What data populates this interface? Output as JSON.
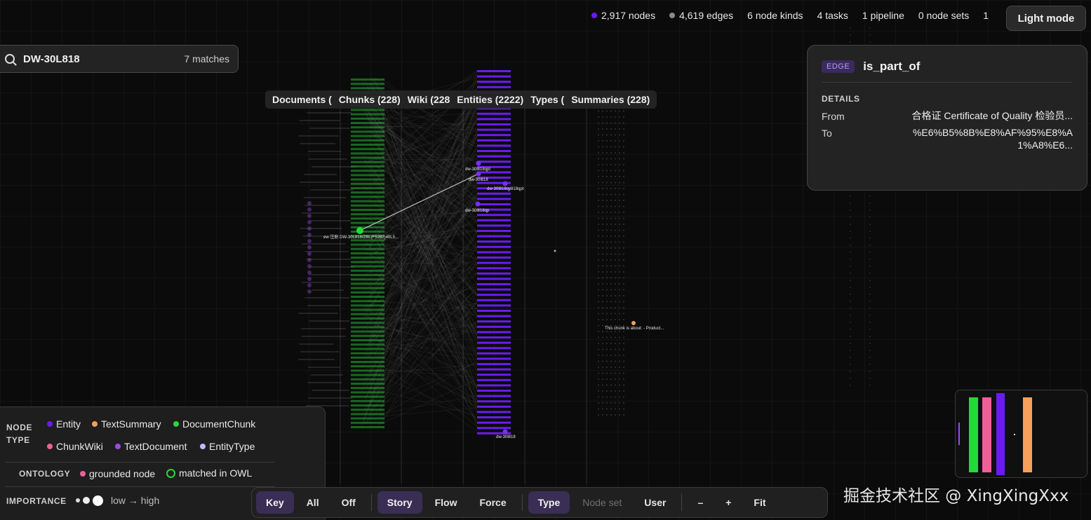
{
  "stats": [
    {
      "label": "2,917 nodes",
      "color": "#6a1bf0",
      "dot": true
    },
    {
      "label": "4,619 edges",
      "color": "#8a8a8a",
      "dot": true
    },
    {
      "label": "6 node kinds",
      "dot": false
    },
    {
      "label": "4 tasks",
      "dot": false
    },
    {
      "label": "1 pipeline",
      "dot": false
    },
    {
      "label": "0 node sets",
      "dot": false
    },
    {
      "label": "1",
      "dot": false
    }
  ],
  "theme_toggle": "Light mode",
  "search": {
    "value": "DW-30L818",
    "matches": "7 matches"
  },
  "columns": [
    "Documents (",
    "Chunks (228)",
    "Wiki (228",
    "Entities (2222)",
    "Types (",
    "Summaries (228)"
  ],
  "edge_panel": {
    "badge": "EDGE",
    "title": "is_part_of",
    "details_label": "DETAILS",
    "from_label": "From",
    "from_value": "合格证 Certificate of Quality 检验员...",
    "to_label": "To",
    "to_value": "%E6%B5%8B%E8%AF%95%E8%A1%A8%E6..."
  },
  "graph_labels": {
    "chunk_label": "ew 注册 DW-30L818/ZBL(F5282)40L5...",
    "summary_label": "This chunk is about: - Product...",
    "entity_labels": [
      "dw-30l818qpt",
      "dw-30l818",
      "dw-30l818qy818qpt",
      "dw-30l818qp",
      "dw-30l818"
    ]
  },
  "legend": {
    "node_type_label_1": "NODE",
    "node_type_label_2": "TYPE",
    "node_types": [
      {
        "name": "Entity",
        "color": "#6a1bf0"
      },
      {
        "name": "TextSummary",
        "color": "#f5a05a"
      },
      {
        "name": "DocumentChunk",
        "color": "#26d93a"
      },
      {
        "name": "ChunkWiki",
        "color": "#ee5f97"
      },
      {
        "name": "TextDocument",
        "color": "#9a4ae8"
      },
      {
        "name": "EntityType",
        "color": "#c7b7f4"
      }
    ],
    "ontology_label": "ONTOLOGY",
    "grounded": "grounded node",
    "grounded_color": "#ee5f97",
    "matched": "matched in OWL",
    "importance_label": "IMPORTANCE",
    "importance_text": "low → high"
  },
  "toolbar": {
    "group1": [
      {
        "label": "Key",
        "active": true
      },
      {
        "label": "All"
      },
      {
        "label": "Off"
      }
    ],
    "group2": [
      {
        "label": "Story",
        "active": true
      },
      {
        "label": "Flow"
      },
      {
        "label": "Force"
      }
    ],
    "group3": [
      {
        "label": "Type",
        "active": true
      },
      {
        "label": "Node set",
        "disabled": true
      },
      {
        "label": "User"
      }
    ],
    "group4": [
      {
        "label": "–"
      },
      {
        "label": "+"
      },
      {
        "label": "Fit"
      }
    ]
  },
  "watermark": "掘金技术社区 @ XingXingXxx"
}
